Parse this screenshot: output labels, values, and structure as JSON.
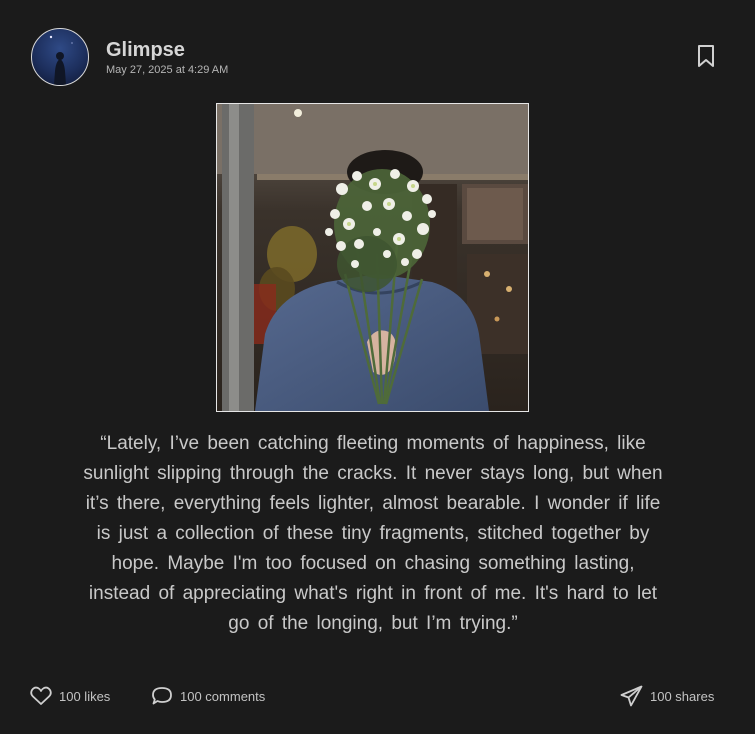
{
  "post": {
    "username": "Glimpse",
    "timestamp": "May 27, 2025 at 4:29 AM",
    "caption": "“Lately, I’ve been catching fleeting moments of happiness, like sunlight slipping through the cracks. It never stays long, but when it’s there, everything feels lighter, almost bearable. I wonder if life is just a collection of these tiny fragments, stitched together by hope. Maybe I'm too focused on chasing something lasting, instead of appreciating what's right in front of me. It's hard to let go of the longing, but I’m trying.”"
  },
  "actions": {
    "likes_label": "100 likes",
    "comments_label": "100 comments",
    "shares_label": "100 shares"
  },
  "icons": {
    "bookmark": "bookmark-icon",
    "like": "heart-icon",
    "comment": "comment-icon",
    "share": "send-icon"
  },
  "colors": {
    "background": "#1b1b1b",
    "text": "#c9c9c9",
    "sweater": "#4a5d82"
  }
}
